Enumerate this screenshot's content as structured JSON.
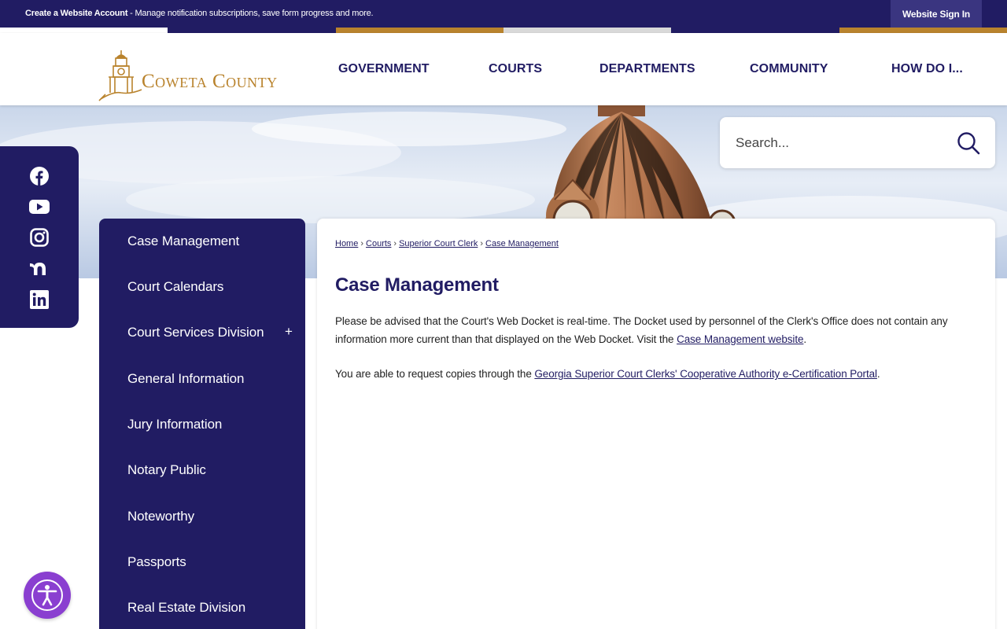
{
  "topbar": {
    "account_link": "Create a Website Account",
    "account_text": " - Manage notification subscriptions, save form progress and more.",
    "signin": "Website Sign In"
  },
  "stripe_colors": [
    "#ffffff",
    "#211c63",
    "#b9832d",
    "#d9d9d9",
    "#211c63",
    "#b9832d"
  ],
  "brand": {
    "name": "Coweta County",
    "accent": "#b9832d",
    "primary": "#211c63"
  },
  "nav": {
    "items": [
      "GOVERNMENT",
      "COURTS",
      "DEPARTMENTS",
      "COMMUNITY",
      "HOW DO I..."
    ]
  },
  "search": {
    "placeholder": "Search...",
    "icon": "search-icon"
  },
  "social": {
    "icons": [
      "facebook-icon",
      "youtube-icon",
      "instagram-icon",
      "nextdoor-icon",
      "linkedin-icon"
    ]
  },
  "sidenav": {
    "items": [
      "Case Management",
      "Court Calendars",
      "Court Services Division",
      "General Information",
      "Jury Information",
      "Notary Public",
      "Noteworthy",
      "Passports",
      "Real Estate Division"
    ],
    "expand": "+"
  },
  "breadcrumb": {
    "items": [
      "Home",
      "Courts",
      "Superior Court Clerk",
      "Case Management"
    ],
    "separator": "›"
  },
  "page": {
    "title": "Case Management",
    "p1_text": "Please be advised that the Court's Web Docket is real-time. The Docket used by personnel of the Clerk's Office does not contain any information more current than that displayed on the Web Docket. Visit the ",
    "p1_link": "Case Management website",
    "p1_end": ".",
    "p2_text": "You are able to request copies through the ",
    "p2_link": "Georgia Superior Court Clerks' Cooperative Authority e-Certification Portal",
    "p2_end": "."
  },
  "a11y": {
    "icon": "accessibility-icon"
  }
}
